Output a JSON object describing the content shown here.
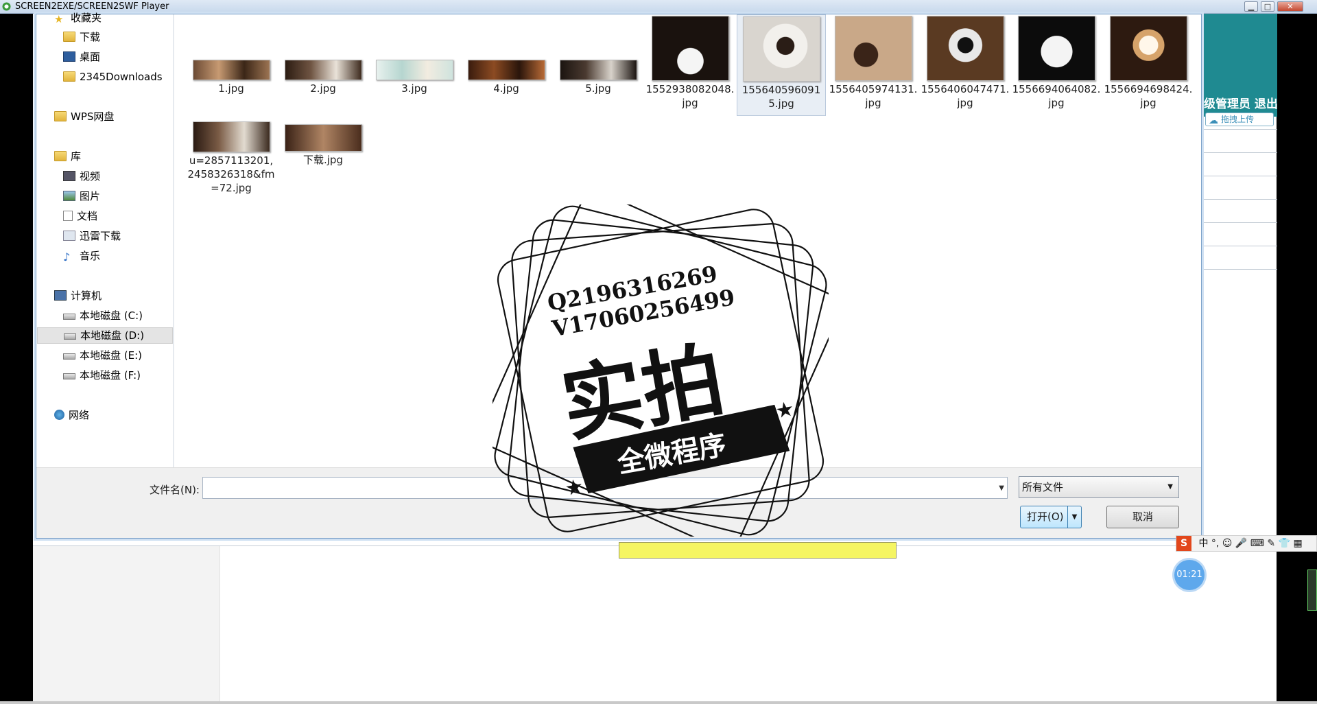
{
  "window": {
    "title": "SCREEN2EXE/SCREEN2SWF Player",
    "min_label": "▁",
    "max_label": "□",
    "close_label": "✕"
  },
  "right_panel": {
    "admin_text": "级管理员 退出",
    "upload_label": "拖拽上传"
  },
  "nav": {
    "items": [
      {
        "label": "收藏夹",
        "icon": "star-icon"
      },
      {
        "label": "下载",
        "icon": "folder-icon"
      },
      {
        "label": "桌面",
        "icon": "desktop-icon"
      },
      {
        "label": "2345Downloads",
        "icon": "folder-icon"
      },
      {
        "label": "WPS网盘",
        "icon": "folder-icon"
      },
      {
        "label": "库",
        "icon": "library-icon"
      },
      {
        "label": "视频",
        "icon": "video-icon"
      },
      {
        "label": "图片",
        "icon": "picture-icon"
      },
      {
        "label": "文档",
        "icon": "document-icon"
      },
      {
        "label": "迅雷下载",
        "icon": "download-icon"
      },
      {
        "label": "音乐",
        "icon": "music-icon"
      },
      {
        "label": "计算机",
        "icon": "computer-icon"
      },
      {
        "label": "本地磁盘 (C:)",
        "icon": "drive-icon"
      },
      {
        "label": "本地磁盘 (D:)",
        "icon": "drive-icon"
      },
      {
        "label": "本地磁盘 (E:)",
        "icon": "drive-icon"
      },
      {
        "label": "本地磁盘 (F:)",
        "icon": "drive-icon"
      },
      {
        "label": "网络",
        "icon": "network-icon"
      }
    ]
  },
  "files": [
    {
      "name": "1.jpg"
    },
    {
      "name": "2.jpg"
    },
    {
      "name": "3.jpg"
    },
    {
      "name": "4.jpg"
    },
    {
      "name": "5.jpg"
    },
    {
      "name": "1552938082048.jpg"
    },
    {
      "name": "1556405960915.jpg"
    },
    {
      "name": "1556405974131.jpg"
    },
    {
      "name": "1556406047471.jpg"
    },
    {
      "name": "1556694064082.jpg"
    },
    {
      "name": "1556694698424.jpg"
    },
    {
      "name": "u=2857113201,2458326318&fm=72.jpg"
    },
    {
      "name": "下载.jpg"
    }
  ],
  "footer": {
    "filename_label": "文件名(N):",
    "filename_value": "",
    "filetype_value": "所有文件",
    "open_label": "打开(O)",
    "cancel_label": "取消"
  },
  "watermark": {
    "line1": "Q2196316269",
    "line2": "V17060256499",
    "big": "实拍",
    "banner": "全微程序"
  },
  "ime": {
    "logo": "S",
    "icons": "中 °, ☺ 🎤 ⌨ ✎ 👕 ▦"
  },
  "timer": "01:21",
  "colors": {
    "accent": "#1f8a91",
    "dialog_border": "#7aa0c8",
    "highlight": "#f5f562"
  }
}
